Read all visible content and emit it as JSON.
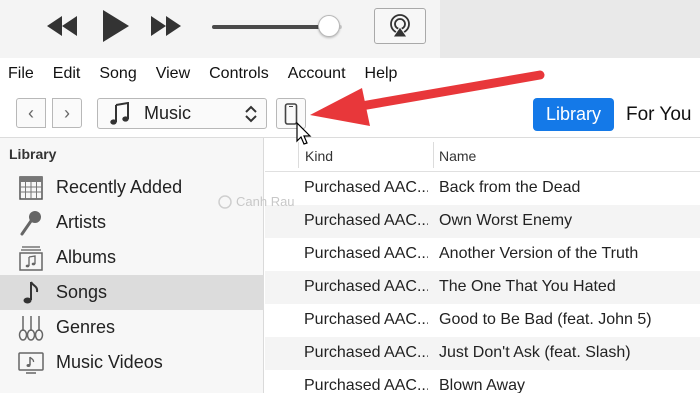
{
  "player": {
    "rewind_icon": "rewind-icon",
    "play_icon": "play-icon",
    "forward_icon": "fast-forward-icon",
    "volume_level": 0.9,
    "airplay_icon": "airplay-icon"
  },
  "menubar": {
    "items": [
      "File",
      "Edit",
      "Song",
      "View",
      "Controls",
      "Account",
      "Help"
    ]
  },
  "toolbar": {
    "back_glyph": "‹",
    "forward_glyph": "›",
    "media_label": "Music",
    "device_icon": "iphone-icon",
    "tab_library": "Library",
    "tab_foryou": "For You",
    "accent_color": "#1479e8",
    "annotation_color": "#e8373a"
  },
  "sidebar": {
    "header": "Library",
    "items": [
      {
        "label": "Recently Added",
        "icon": "calendar-grid-icon"
      },
      {
        "label": "Artists",
        "icon": "microphone-icon"
      },
      {
        "label": "Albums",
        "icon": "album-icon"
      },
      {
        "label": "Songs",
        "icon": "music-note-icon",
        "selected": true
      },
      {
        "label": "Genres",
        "icon": "guitars-icon"
      },
      {
        "label": "Music Videos",
        "icon": "music-video-icon"
      }
    ]
  },
  "table": {
    "columns": [
      "Kind",
      "Name"
    ],
    "rows": [
      {
        "kind": "Purchased AAC...",
        "name": "Back from the Dead"
      },
      {
        "kind": "Purchased AAC...",
        "name": "Own Worst Enemy"
      },
      {
        "kind": "Purchased AAC...",
        "name": "Another Version of the Truth"
      },
      {
        "kind": "Purchased AAC...",
        "name": "The One That You Hated"
      },
      {
        "kind": "Purchased AAC...",
        "name": "Good to Be Bad (feat. John 5)"
      },
      {
        "kind": "Purchased AAC...",
        "name": "Just Don't Ask (feat. Slash)"
      },
      {
        "kind": "Purchased AAC...",
        "name": "Blown Away"
      }
    ]
  },
  "watermark": "Canh Rau"
}
